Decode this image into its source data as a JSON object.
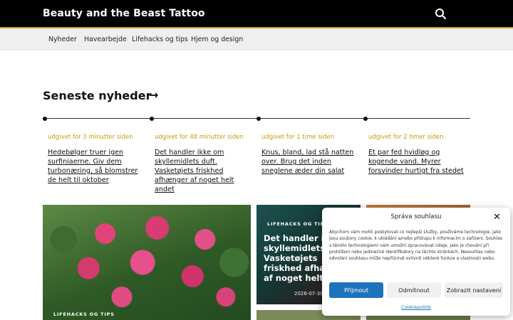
{
  "header": {
    "site_title": "Beauty and the Beast Tattoo",
    "search_icon": "search-icon"
  },
  "nav": {
    "items": [
      {
        "label": "Nyheder"
      },
      {
        "label": "Havearbejde"
      },
      {
        "label": "Lifehacks og tips"
      },
      {
        "label": "Hjem og design"
      }
    ]
  },
  "latest": {
    "heading": "Seneste nyheder",
    "arrow": "→",
    "items": [
      {
        "time": "udgivet for 3 minutter siden",
        "title": "Hedebølger truer igen surfiniaerne. Giv dem turbonæring, så blomstrer de helt til oktober"
      },
      {
        "time": "udgivet for 48 minutter siden",
        "title": "Det handler ikke om skyllemidlets duft. Vasketøjets friskhed afhænger af noget helt andet"
      },
      {
        "time": "udgivet for 1 time siden",
        "title": "Knus, bland, lad stå natten over. Brug det inden sneglene æder din salat"
      },
      {
        "time": "udgivet for 2 timer siden",
        "title": "Et par fed hvidløg og kogende vand. Myrer forsvinder hurtigt fra stedet"
      }
    ]
  },
  "cards": {
    "big": {
      "category": "LIFEHACKS OG TIPS"
    },
    "mid": {
      "category": "LIFEHACKS OG TIPS",
      "title": "Det handler i\nskyllemidlets\nVasketøjets\nfriskhed afha\naf noget helt",
      "date": "2026-07-30"
    }
  },
  "consent": {
    "title": "Správa souhlasu",
    "body": "Abychom vám mohli poskytovat co nejlepší služby, používáme technologie, jako jsou soubory cookie, k ukládání a/nebo přístupu k informacím o zařízení. Souhlas s těmito technologiemi nám umožní zpracovávat údaje, jako je chování při prohlížení nebo jedinečné identifikátory na těchto stránkách. Nesouhlas nebo odvolání souhlasu může nepříznivě ovlivnit některé funkce a vlastnosti webu.",
    "accept": "Přijmout",
    "reject": "Odmítnout",
    "settings": "Zobrazit nastavení",
    "policy_link": "Cookiepolitik",
    "accent": "#1e73be"
  },
  "colors": {
    "header_bg": "#000000",
    "accent_gold": "#c9a227",
    "time_color": "#c9960c"
  }
}
